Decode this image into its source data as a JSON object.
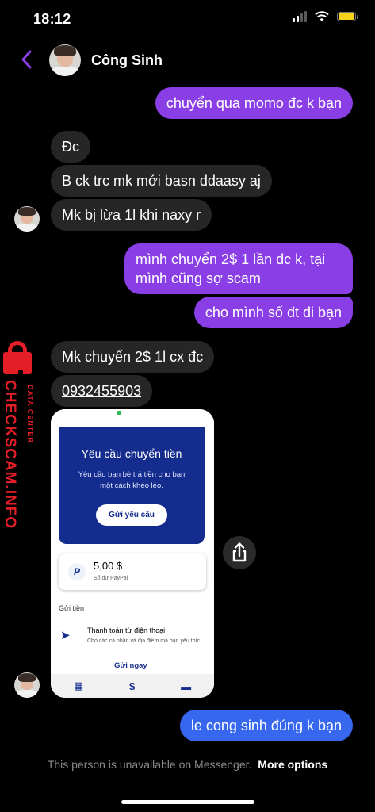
{
  "status_bar": {
    "time": "18:12"
  },
  "header": {
    "contact_name": "Công Sinh"
  },
  "messages": {
    "m1": "chuyển qua momo đc k bạn",
    "m2": "Đc",
    "m3": "B ck trc mk mới basn ddaasy aj",
    "m4": "Mk bị lừa 1l khi naxy r",
    "m5_line1": "mình chuyển 2$ 1 lần đc k, tại",
    "m5_line2": "mình cũng sợ scam",
    "m6": "cho mình số đt đi bạn",
    "m7": "Mk chuyển 2$ 1l cx đc",
    "m8": "0932455903",
    "m9": "le cong sinh đúng k bạn"
  },
  "watermark": {
    "big": "CHECKSCAM.INFO",
    "small": "DATA CENTER"
  },
  "paypal": {
    "card_title": "Yêu cầu chuyển tiền",
    "card_desc": "Yêu cầu bạn bè trả tiền cho bạn một cách khéo léo.",
    "card_button": "Gửi yêu cầu",
    "balance": "5,00 $",
    "balance_label": "Số dư PayPal",
    "send_heading": "Gửi tiền",
    "pay_title": "Thanh toán từ điện thoại",
    "pay_desc": "Cho các cá nhân và địa điểm mà bạn yêu thíc",
    "send_now": "Gửi ngay",
    "logo_letter": "P"
  },
  "footer": {
    "notice": "This person is unavailable on Messenger.",
    "more_options": "More options"
  },
  "colors": {
    "outgoing": "#8a3ee6",
    "outgoing_last": "#3667ee",
    "incoming": "#262626",
    "watermark": "#e41e26"
  }
}
